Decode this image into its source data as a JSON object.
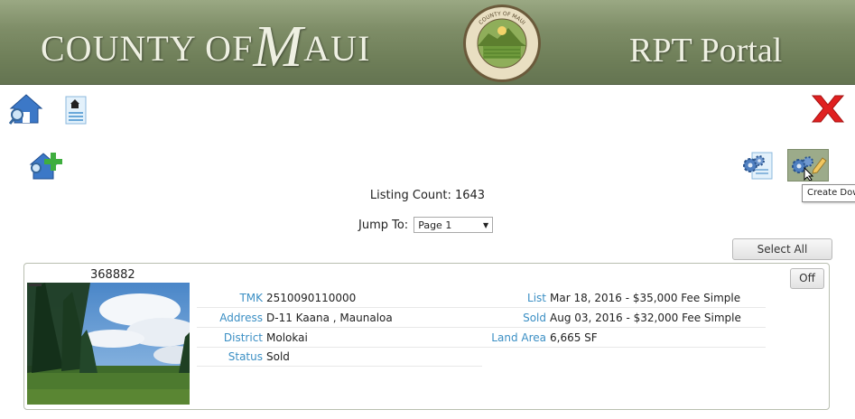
{
  "banner": {
    "title_pre": "COUNTY OF",
    "title_big": "M",
    "title_post": "AUI",
    "portal": "RPT Portal",
    "seal_top": "COUNTY OF MAUI",
    "seal_bottom": "STATE OF HAWAII"
  },
  "toolbar": {
    "icons": [
      "home-search-icon",
      "house-document-icon",
      "close-icon",
      "add-property-icon",
      "gears-document-icon",
      "create-download-icon"
    ],
    "tooltip": "Create Download"
  },
  "listing_count_label": "Listing Count: 1643",
  "jump": {
    "label": "Jump To:",
    "selected": "Page 1"
  },
  "select_all": "Select All",
  "listing": {
    "id": "368882",
    "toggle": "Off",
    "left": [
      {
        "key": "TMK",
        "value": "2510090110000"
      },
      {
        "key": "Address",
        "value": "D-11 Kaana , Maunaloa"
      },
      {
        "key": "District",
        "value": "Molokai"
      },
      {
        "key": "Status",
        "value": "Sold"
      }
    ],
    "right": [
      {
        "key": "List",
        "value": "Mar 18, 2016 - $35,000 Fee Simple"
      },
      {
        "key": "Sold",
        "value": "Aug 03, 2016 - $32,000 Fee Simple"
      },
      {
        "key": "Land Area",
        "value": "6,665 SF"
      }
    ]
  },
  "colors": {
    "banner": "#7e8d67",
    "link": "#3b8fc4",
    "close": "#e02020"
  }
}
